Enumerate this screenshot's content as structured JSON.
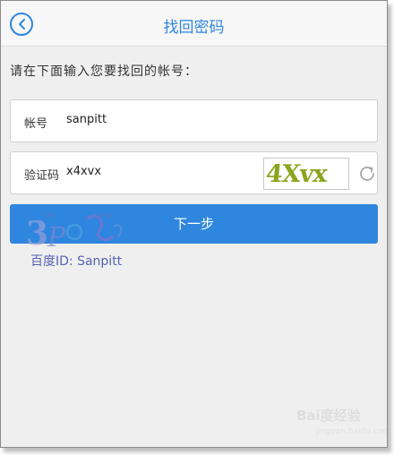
{
  "header": {
    "title": "找回密码"
  },
  "prompt": "请在下面输入您要找回的帐号：",
  "account": {
    "label": "帐号",
    "value": "sanpitt"
  },
  "verify": {
    "label": "验证码",
    "value": "x4xvx",
    "captcha_text": "4Xvx"
  },
  "next_button": "下一步",
  "watermark": {
    "text": "百度ID: Sanpitt",
    "baidu_brand": "Bai度经验",
    "baidu_sub": "jingyan.baidu.com"
  },
  "colors": {
    "accent": "#2f86de",
    "background": "#efefef",
    "captcha": "#8aa61e"
  }
}
